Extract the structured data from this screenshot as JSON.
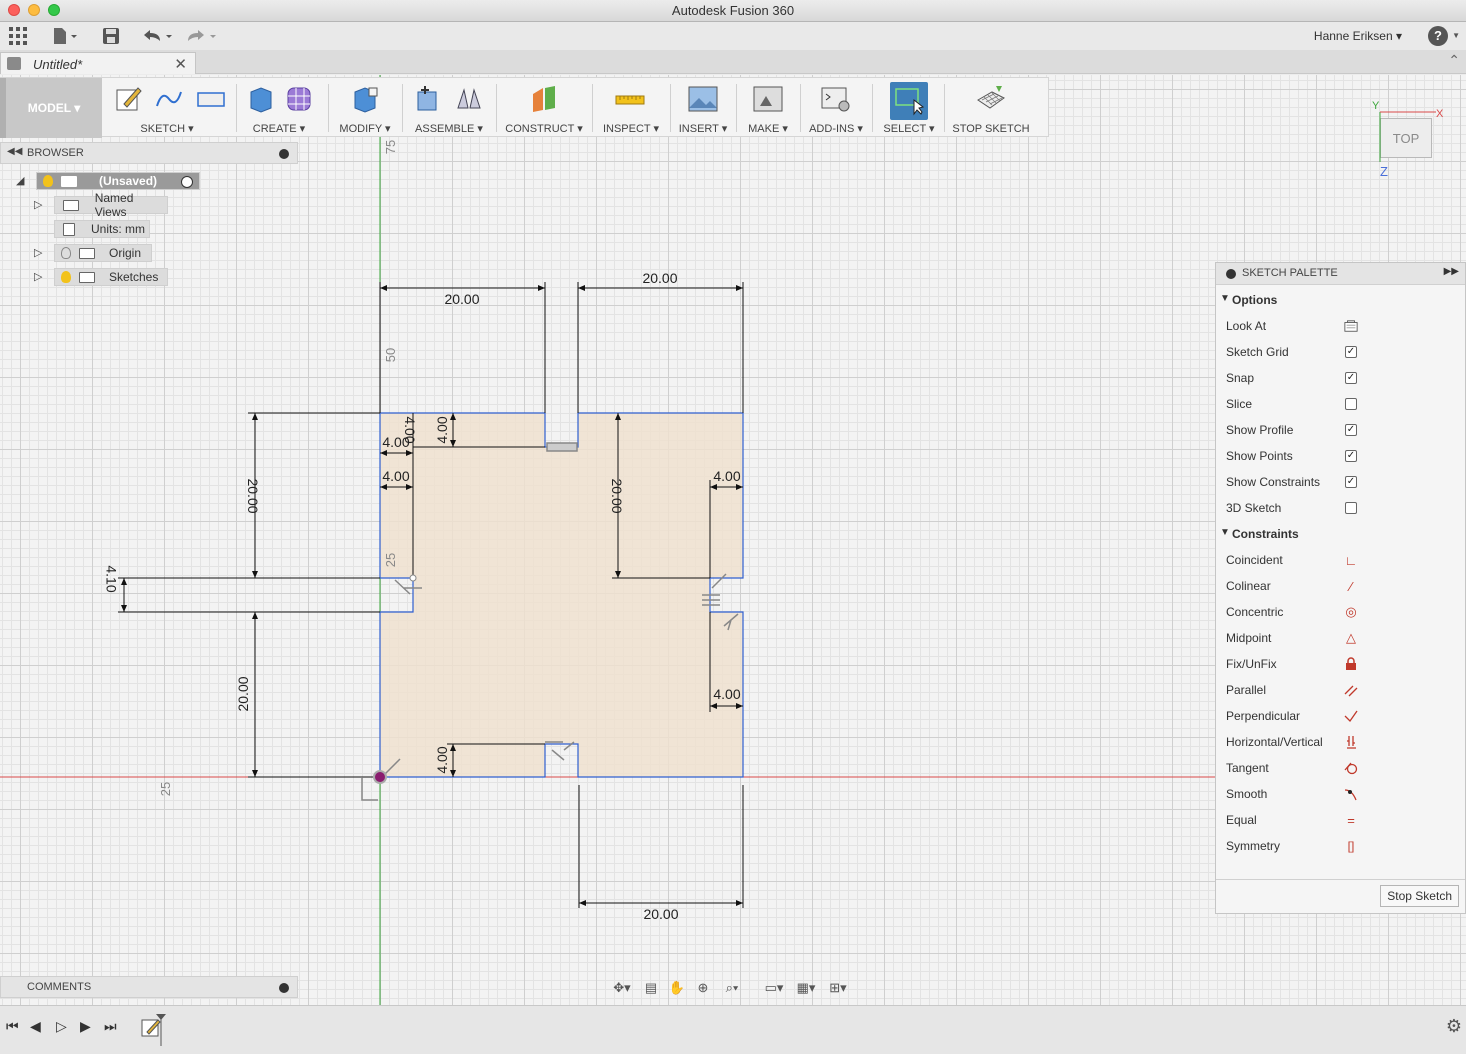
{
  "window": {
    "title": "Autodesk Fusion 360"
  },
  "quick_access": {
    "user_name": "Hanne Eriksen ▾",
    "help": "?"
  },
  "document_tab": {
    "name": "Untitled*"
  },
  "toolbar": {
    "workspace": "MODEL ▾",
    "groups": [
      {
        "label": "SKETCH ▾",
        "icon": "sketch-icon"
      },
      {
        "label": "CREATE ▾",
        "icon": "create-icon"
      },
      {
        "label": "MODIFY ▾",
        "icon": "modify-icon"
      },
      {
        "label": "ASSEMBLE ▾",
        "icon": "assemble-icon"
      },
      {
        "label": "CONSTRUCT ▾",
        "icon": "construct-icon"
      },
      {
        "label": "INSPECT ▾",
        "icon": "inspect-icon"
      },
      {
        "label": "INSERT ▾",
        "icon": "insert-icon"
      },
      {
        "label": "MAKE ▾",
        "icon": "make-icon"
      },
      {
        "label": "ADD-INS ▾",
        "icon": "addins-icon"
      },
      {
        "label": "SELECT ▾",
        "icon": "select-icon"
      },
      {
        "label": "STOP SKETCH",
        "icon": "stop-sketch-icon"
      }
    ]
  },
  "browser": {
    "title": "BROWSER",
    "root": "(Unsaved)",
    "items": [
      {
        "label": "Named Views"
      },
      {
        "label": "Units: mm"
      },
      {
        "label": "Origin"
      },
      {
        "label": "Sketches"
      }
    ]
  },
  "comments": {
    "title": "COMMENTS"
  },
  "viewcube": {
    "face": "TOP",
    "axis_x": "X",
    "axis_y": "Y",
    "axis_z": "Z"
  },
  "sketch": {
    "dims": {
      "top_left_width": "20.00",
      "top_right_width": "20.00",
      "bottom_width": "20.00",
      "left_upper_height": "20.00",
      "left_lower_height": "20.00",
      "right_height": "20.00",
      "slot_gap": "4.10",
      "d_a": "4.00",
      "d_b": "4.00",
      "d_c": "4.00",
      "d_d": "4.00",
      "d_e": "4.00",
      "d_f": "4.00",
      "d_g": "4.00",
      "d_h": "4.00"
    },
    "ruler": {
      "r75": "75",
      "r50": "50",
      "r25": "25",
      "r25b": "25"
    }
  },
  "palette": {
    "title": "SKETCH PALETTE",
    "options_title": "Options",
    "options": [
      {
        "label": "Look At",
        "type": "icon"
      },
      {
        "label": "Sketch Grid",
        "checked": true
      },
      {
        "label": "Snap",
        "checked": true
      },
      {
        "label": "Slice",
        "checked": false
      },
      {
        "label": "Show Profile",
        "checked": true
      },
      {
        "label": "Show Points",
        "checked": true
      },
      {
        "label": "Show Constraints",
        "checked": true
      },
      {
        "label": "3D Sketch",
        "checked": false
      }
    ],
    "constraints_title": "Constraints",
    "constraints": [
      {
        "label": "Coincident",
        "icon": "coincident-icon",
        "glyph": "∟"
      },
      {
        "label": "Colinear",
        "icon": "colinear-icon",
        "glyph": "⁄"
      },
      {
        "label": "Concentric",
        "icon": "concentric-icon",
        "glyph": "◎"
      },
      {
        "label": "Midpoint",
        "icon": "midpoint-icon",
        "glyph": "△"
      },
      {
        "label": "Fix/UnFix",
        "icon": "lock-icon",
        "glyph": "🔒"
      },
      {
        "label": "Parallel",
        "icon": "parallel-icon",
        "glyph": "∥"
      },
      {
        "label": "Perpendicular",
        "icon": "perpendicular-icon",
        "glyph": "∠"
      },
      {
        "label": "Horizontal/Vertical",
        "icon": "horizontal-vertical-icon",
        "glyph": "⊥"
      },
      {
        "label": "Tangent",
        "icon": "tangent-icon",
        "glyph": "⌒"
      },
      {
        "label": "Smooth",
        "icon": "smooth-icon",
        "glyph": "↘"
      },
      {
        "label": "Equal",
        "icon": "equal-icon",
        "glyph": "="
      },
      {
        "label": "Symmetry",
        "icon": "symmetry-icon",
        "glyph": "[]"
      }
    ],
    "stop_label": "Stop Sketch"
  }
}
